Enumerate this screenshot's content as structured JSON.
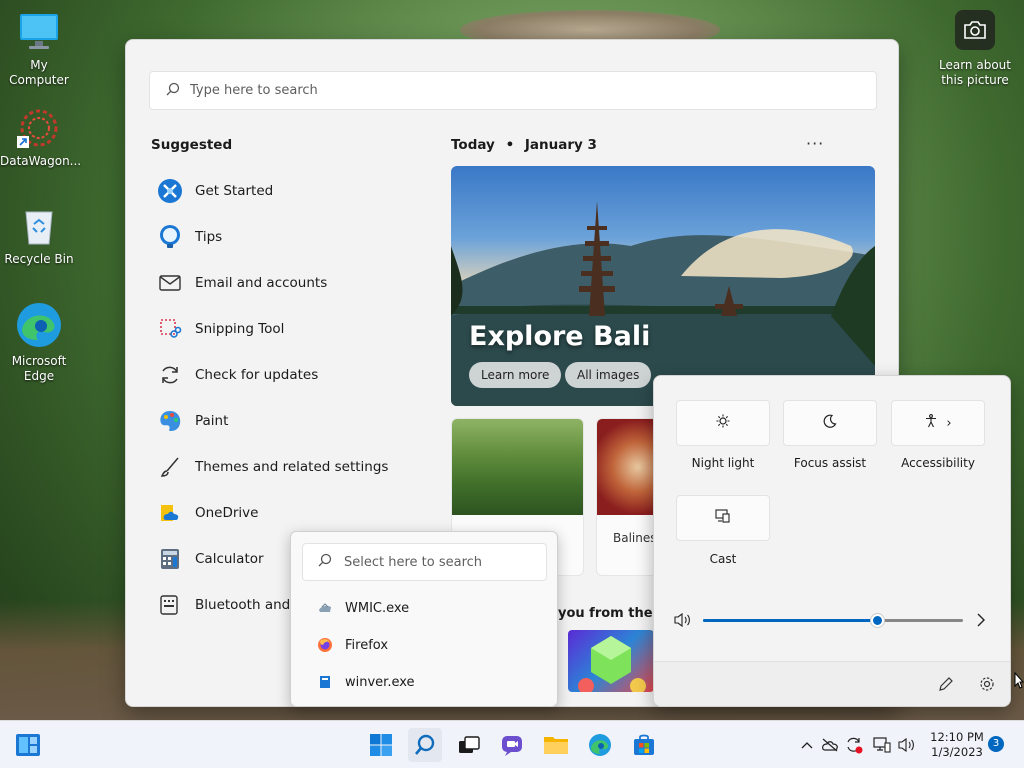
{
  "desktop": {
    "icons": [
      {
        "label": "My Computer",
        "icon": "monitor-icon"
      },
      {
        "label": "DataWagon...",
        "icon": "datawagon-icon"
      },
      {
        "label": "Recycle Bin",
        "icon": "recycle-bin-icon"
      },
      {
        "label": "Microsoft Edge",
        "icon": "edge-icon"
      }
    ],
    "learn_picture": {
      "label": "Learn about this picture",
      "icon": "camera-icon"
    }
  },
  "start_menu": {
    "search_placeholder": "Type here to search",
    "suggested_title": "Suggested",
    "suggested": [
      {
        "label": "Get Started",
        "icon": "get-started-icon"
      },
      {
        "label": "Tips",
        "icon": "tips-icon"
      },
      {
        "label": "Email and accounts",
        "icon": "mail-icon"
      },
      {
        "label": "Snipping Tool",
        "icon": "snipping-tool-icon"
      },
      {
        "label": "Check for updates",
        "icon": "refresh-icon"
      },
      {
        "label": "Paint",
        "icon": "paint-icon"
      },
      {
        "label": "Themes and related settings",
        "icon": "brush-icon"
      },
      {
        "label": "OneDrive",
        "icon": "onedrive-icon"
      },
      {
        "label": "Calculator",
        "icon": "calculator-icon"
      },
      {
        "label": "Bluetooth and o",
        "icon": "bluetooth-keyboard-icon"
      }
    ],
    "today": {
      "label": "Today",
      "separator": "•",
      "date": "January 3"
    },
    "more": "···",
    "hero": {
      "title": "Explore Bali",
      "learn_more": "Learn more",
      "all_images": "All images"
    },
    "cards": [
      {
        "caption": ""
      },
      {
        "caption": "Balinese"
      }
    ],
    "you_from": "you from the w"
  },
  "popup_search": {
    "placeholder": "Select here to search",
    "items": [
      {
        "label": "WMIC.exe",
        "icon": "wmic-icon"
      },
      {
        "label": "Firefox",
        "icon": "firefox-icon"
      },
      {
        "label": "winver.exe",
        "icon": "winver-icon"
      }
    ]
  },
  "quick_settings": {
    "tiles": [
      {
        "label": "Night light",
        "icon": "brightness-icon"
      },
      {
        "label": "Focus assist",
        "icon": "moon-icon"
      },
      {
        "label": "Accessibility",
        "icon": "accessibility-icon",
        "chevron": "›"
      },
      {
        "label": "Cast",
        "icon": "cast-icon"
      }
    ],
    "volume_percent": 67
  },
  "taskbar": {
    "clock_time": "12:10 PM",
    "clock_date": "1/3/2023",
    "notification_count": "3"
  },
  "colors": {
    "accent": "#0067c0"
  }
}
